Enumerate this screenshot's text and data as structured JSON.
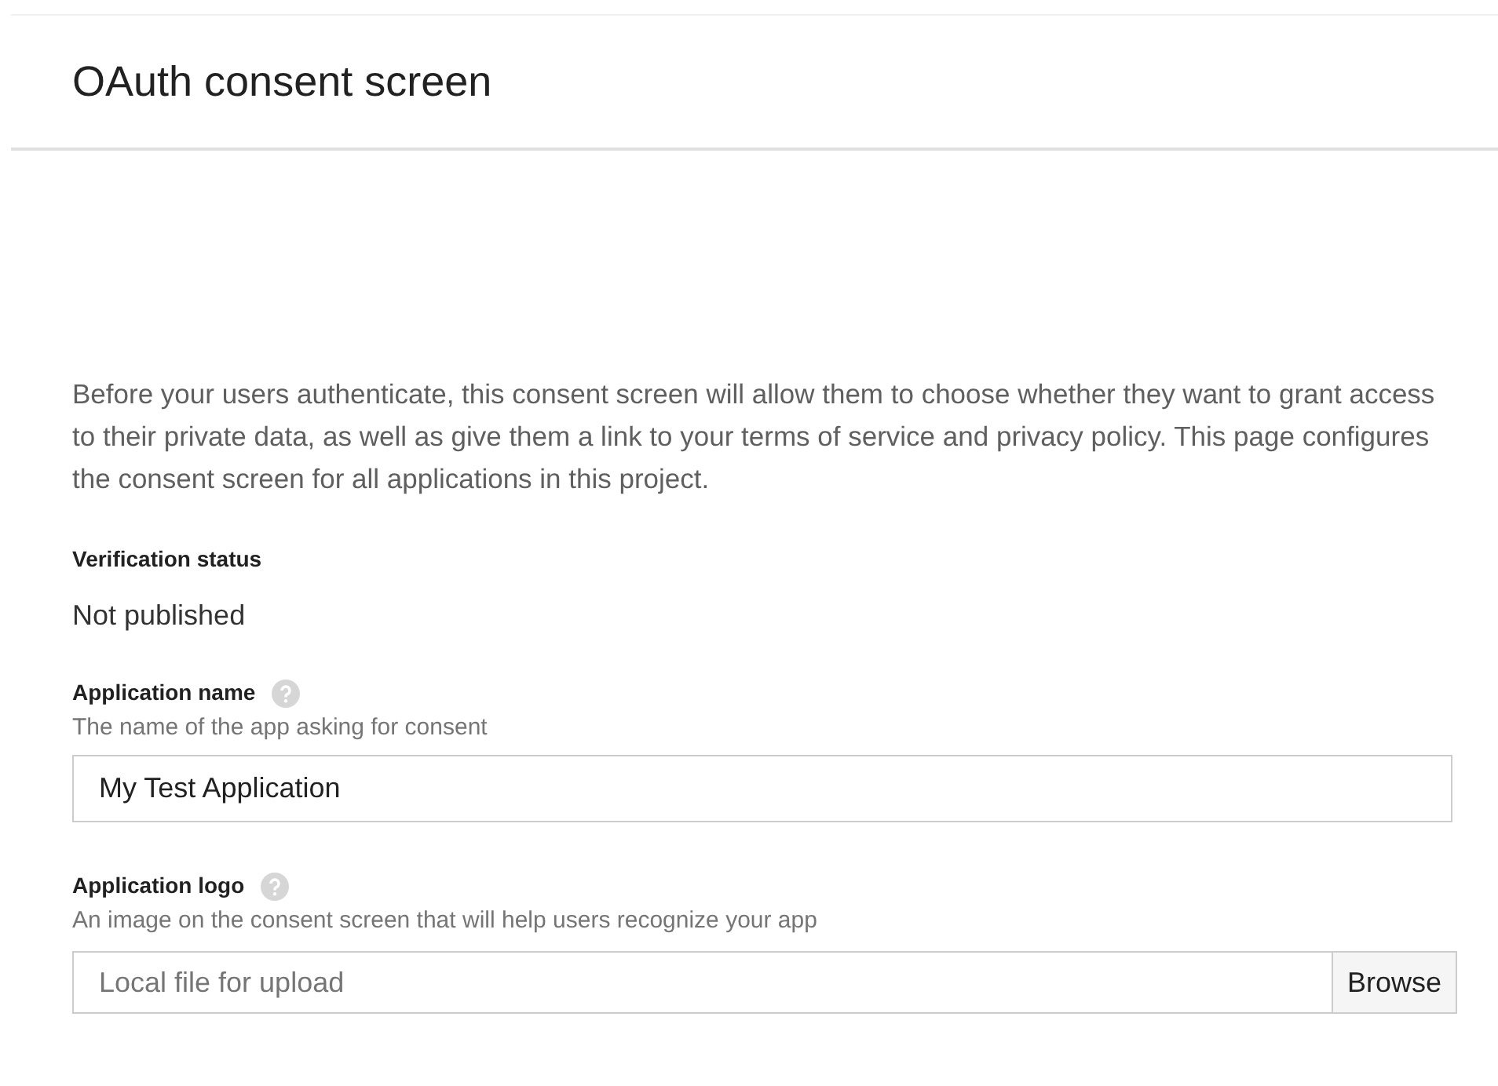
{
  "header": {
    "title": "OAuth consent screen"
  },
  "description": "Before your users authenticate, this consent screen will allow them to choose whether they want to grant access to their private data, as well as give them a link to your terms of service and privacy policy. This page configures the consent screen for all applications in this project.",
  "verification": {
    "label": "Verification status",
    "value": "Not published"
  },
  "fields": [
    {
      "kind": "text",
      "label": "Application name",
      "hint": "The name of the app asking for consent",
      "value": "My Test Application"
    },
    {
      "kind": "file",
      "label": "Application logo",
      "hint": "An image on the consent screen that will help users recognize your app",
      "placeholder": "Local file for upload",
      "button": "Browse"
    }
  ]
}
